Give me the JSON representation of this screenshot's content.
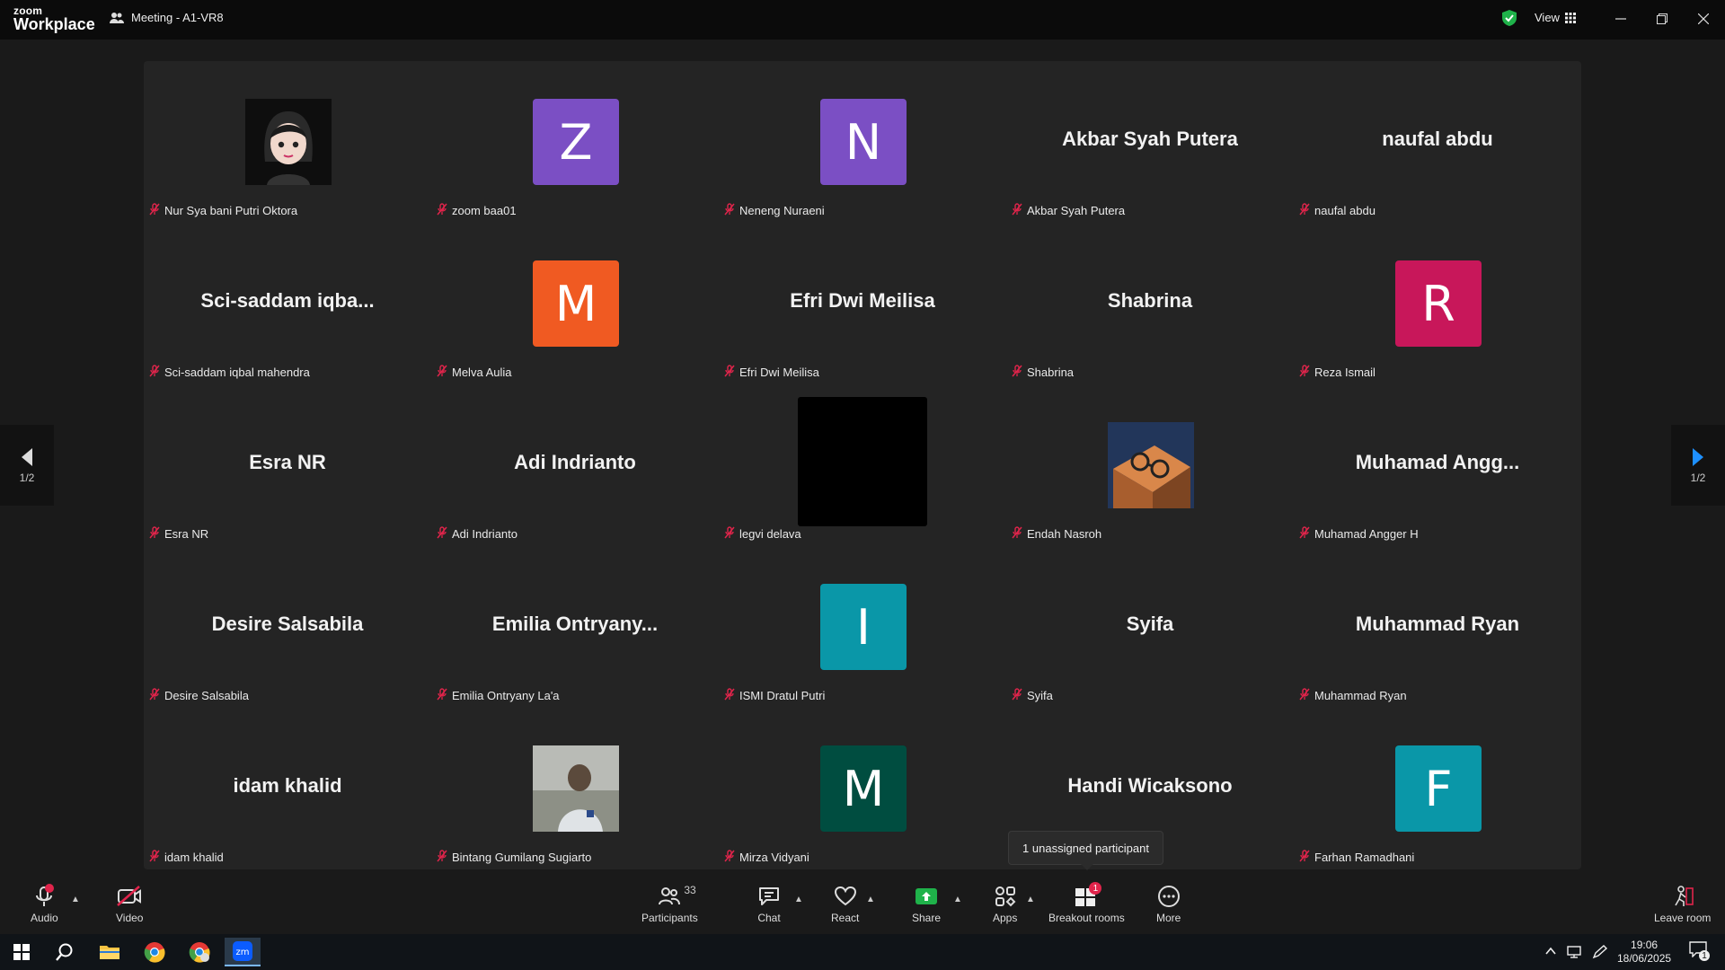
{
  "app": {
    "logo_line1": "zoom",
    "logo_line2": "Workplace",
    "meeting_title": "Meeting - A1-VR8",
    "view_label": "View"
  },
  "pager": {
    "left": "1/2",
    "right": "1/2"
  },
  "tiles": [
    {
      "label": "Nur Sya bani Putri Oktora",
      "big": "",
      "avatar_letter": "",
      "avatar_color": "",
      "kind": "photo-cartoon"
    },
    {
      "label": "zoom baa01",
      "big": "",
      "avatar_letter": "Z",
      "avatar_color": "#7b4fc4",
      "kind": "letter"
    },
    {
      "label": "Neneng Nuraeni",
      "big": "",
      "avatar_letter": "N",
      "avatar_color": "#7b4fc4",
      "kind": "letter"
    },
    {
      "label": "Akbar Syah Putera",
      "big": "Akbar Syah Putera",
      "kind": "name"
    },
    {
      "label": "naufal abdu",
      "big": "naufal abdu",
      "kind": "name"
    },
    {
      "label": "Sci-saddam iqbal mahendra",
      "big": "Sci-saddam iqba...",
      "kind": "name"
    },
    {
      "label": "Melva Aulia",
      "big": "",
      "avatar_letter": "M",
      "avatar_color": "#f05a22",
      "kind": "letter"
    },
    {
      "label": "Efri Dwi Meilisa",
      "big": "Efri Dwi Meilisa",
      "kind": "name"
    },
    {
      "label": "Shabrina",
      "big": "Shabrina",
      "kind": "name"
    },
    {
      "label": "Reza Ismail",
      "big": "",
      "avatar_letter": "R",
      "avatar_color": "#c8175a",
      "kind": "letter"
    },
    {
      "label": "Esra NR",
      "big": "Esra NR",
      "kind": "name"
    },
    {
      "label": "Adi Indrianto",
      "big": "Adi Indrianto",
      "kind": "name"
    },
    {
      "label": "legvi delava",
      "big": "",
      "kind": "black"
    },
    {
      "label": "Endah Nasroh",
      "big": "",
      "kind": "photo-glasses"
    },
    {
      "label": "Muhamad Angger H",
      "big": "Muhamad  Angg...",
      "kind": "name"
    },
    {
      "label": "Desire Salsabila",
      "big": "Desire Salsabila",
      "kind": "name"
    },
    {
      "label": "Emilia Ontryany La'a",
      "big": "Emilia  Ontryany...",
      "kind": "name"
    },
    {
      "label": "ISMI Dratul Putri",
      "big": "",
      "avatar_letter": "I",
      "avatar_color": "#0a97a8",
      "kind": "letter"
    },
    {
      "label": "Syifa",
      "big": "Syifa",
      "kind": "name"
    },
    {
      "label": "Muhammad Ryan",
      "big": "Muhammad Ryan",
      "kind": "name"
    },
    {
      "label": "idam khalid",
      "big": "idam khalid",
      "kind": "name"
    },
    {
      "label": "Bintang Gumilang Sugiarto",
      "big": "",
      "kind": "photo-person"
    },
    {
      "label": "Mirza Vidyani",
      "big": "",
      "avatar_letter": "M",
      "avatar_color": "#004d40",
      "kind": "letter"
    },
    {
      "label": "",
      "big": "Handi Wicaksono",
      "kind": "name"
    },
    {
      "label": "Farhan Ramadhani",
      "big": "",
      "avatar_letter": "F",
      "avatar_color": "#0a97a8",
      "kind": "letter"
    }
  ],
  "tooltip": "1 unassigned participant",
  "toolbar": {
    "audio": "Audio",
    "video": "Video",
    "participants": "Participants",
    "participants_count": "33",
    "chat": "Chat",
    "react": "React",
    "share": "Share",
    "apps": "Apps",
    "breakout": "Breakout rooms",
    "breakout_badge": "1",
    "more": "More",
    "leave": "Leave room"
  },
  "taskbar": {
    "time": "19:06",
    "date": "18/06/2025",
    "notif_count": "1"
  },
  "colors": {
    "accent_blue": "#0b5cff",
    "share_green": "#1fb24a",
    "muted_red": "#e0244b"
  }
}
